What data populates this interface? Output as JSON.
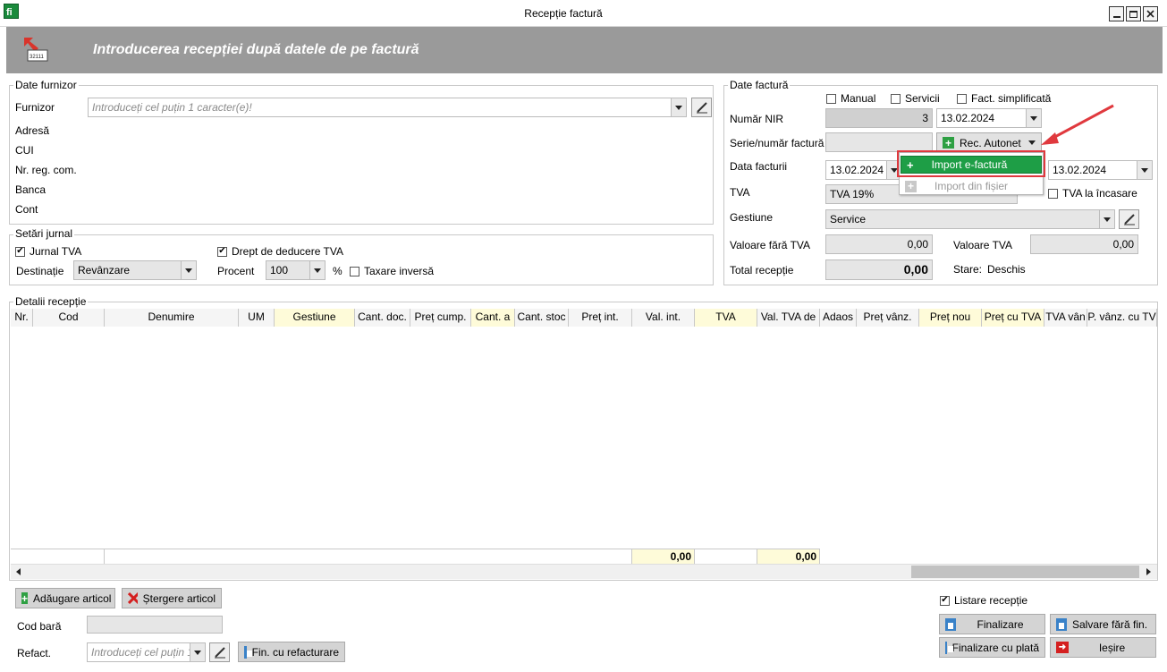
{
  "window": {
    "title": "Recepție factură"
  },
  "banner": {
    "title": "Introducerea recepției după datele de pe factură",
    "icon_text": "32111"
  },
  "supplier": {
    "group_label": "Date furnizor",
    "furnizor_label": "Furnizor",
    "furnizor_placeholder": "Introduceți cel puțin 1 caracter(e)!",
    "adresa_label": "Adresă",
    "cui_label": "CUI",
    "nrreg_label": "Nr. reg. com.",
    "banca_label": "Banca",
    "cont_label": "Cont"
  },
  "journal": {
    "group_label": "Setări jurnal",
    "jurnal_tva": "Jurnal TVA",
    "drept_deducere": "Drept de deducere TVA",
    "destinatie_label": "Destinație",
    "destinatie_value": "Revânzare",
    "procent_label": "Procent",
    "procent_value": "100",
    "percent_sign": "%",
    "taxare_inversa": "Taxare inversă"
  },
  "invoice": {
    "group_label": "Date factură",
    "manual": "Manual",
    "servicii": "Servicii",
    "fact_simplificata": "Fact. simplificată",
    "numar_nir_label": "Număr NIR",
    "numar_nir_value": "3",
    "numar_nir_date": "13.02.2024",
    "serie_label": "Serie/număr factură",
    "rec_autonet": "Rec. Autonet",
    "data_facturii_label": "Data facturii",
    "data_facturii_value": "13.02.2024",
    "scadenta_value": "13.02.2024",
    "tva_label": "TVA",
    "tva_value": "TVA 19%",
    "tva_incasare": "TVA la încasare",
    "gestiune_label": "Gestiune",
    "gestiune_value": "Service",
    "valoare_fara_tva_label": "Valoare fără TVA",
    "valoare_fara_tva_value": "0,00",
    "valoare_tva_label": "Valoare TVA",
    "valoare_tva_value": "0,00",
    "total_label": "Total recepție",
    "total_value": "0,00",
    "stare_label": "Stare:",
    "stare_value": "Deschis"
  },
  "dropdown": {
    "import_efactura": "Import e-factură",
    "import_fisier": "Import din fișier"
  },
  "details": {
    "group_label": "Detalii recepție",
    "columns": [
      "Nr.",
      "Cod",
      "Denumire",
      "UM",
      "Gestiune",
      "Cant. doc.",
      "Preț cump.",
      "Cant. a",
      "Cant. stoc",
      "Preț int.",
      "Val. int.",
      "TVA",
      "Val. TVA de",
      "Adaos",
      "Preț vânz.",
      "Preț nou",
      "Preț cu TVA",
      "TVA vân",
      "P. vânz. cu TV"
    ],
    "totals": {
      "val_int": "0,00",
      "val_tva": "0,00"
    }
  },
  "bottom": {
    "adaugare_articol": "Adăugare articol",
    "stergere_articol": "Ștergere articol",
    "cod_bara_label": "Cod bară",
    "refact_label": "Refact.",
    "refact_placeholder": "Introduceți cel puțin 1",
    "fin_refacturare": "Fin. cu refacturare",
    "listare_receptie": "Listare recepție",
    "finalizare": "Finalizare",
    "salvare_fara_fin": "Salvare fără fin.",
    "finalizare_cu_plata": "Finalizare cu plată",
    "iesire": "Ieșire"
  },
  "colors": {
    "banner": "#9a9a9a",
    "highlight_green": "#1e9e46",
    "annotation_red": "#e0393e",
    "yellow_col": "#fefbd9"
  }
}
